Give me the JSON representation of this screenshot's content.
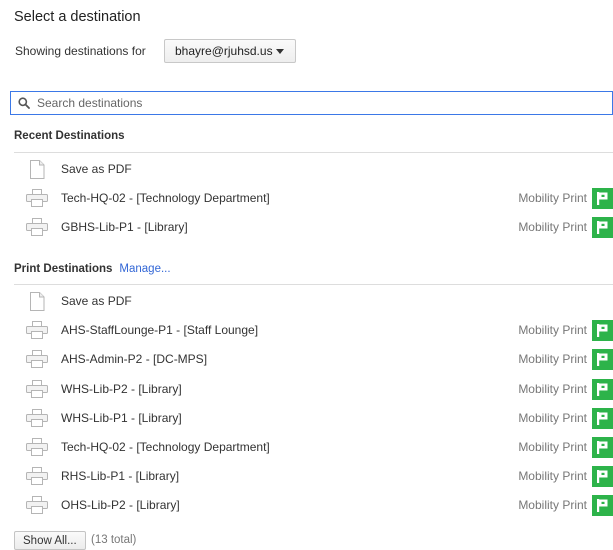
{
  "title": "Select a destination",
  "account": {
    "label": "Showing destinations for",
    "selected": "bhayre@rjuhsd.us"
  },
  "search": {
    "placeholder": "Search destinations"
  },
  "recent": {
    "header": "Recent Destinations",
    "items": [
      {
        "name": "Save as PDF",
        "icon": "pdf-document-icon",
        "provider": ""
      },
      {
        "name": "Tech-HQ-02 - [Technology Department]",
        "icon": "printer-icon",
        "provider": "Mobility Print"
      },
      {
        "name": "GBHS-Lib-P1 - [Library]",
        "icon": "printer-icon",
        "provider": "Mobility Print"
      }
    ]
  },
  "print": {
    "header": "Print Destinations",
    "manage_label": "Manage...",
    "items": [
      {
        "name": "Save as PDF",
        "icon": "pdf-document-icon",
        "provider": ""
      },
      {
        "name": "AHS-StaffLounge-P1 - [Staff Lounge]",
        "icon": "printer-icon",
        "provider": "Mobility Print"
      },
      {
        "name": "AHS-Admin-P2 - [DC-MPS]",
        "icon": "printer-icon",
        "provider": "Mobility Print"
      },
      {
        "name": "WHS-Lib-P2 - [Library]",
        "icon": "printer-icon",
        "provider": "Mobility Print"
      },
      {
        "name": "WHS-Lib-P1 - [Library]",
        "icon": "printer-icon",
        "provider": "Mobility Print"
      },
      {
        "name": "Tech-HQ-02 - [Technology Department]",
        "icon": "printer-icon",
        "provider": "Mobility Print"
      },
      {
        "name": "RHS-Lib-P1 - [Library]",
        "icon": "printer-icon",
        "provider": "Mobility Print"
      },
      {
        "name": "OHS-Lib-P2 - [Library]",
        "icon": "printer-icon",
        "provider": "Mobility Print"
      }
    ]
  },
  "footer": {
    "show_all_label": "Show All...",
    "total_text": "(13 total)"
  },
  "colors": {
    "accent": "#3b78e7",
    "link": "#3367d6",
    "badge": "#2db34a"
  }
}
